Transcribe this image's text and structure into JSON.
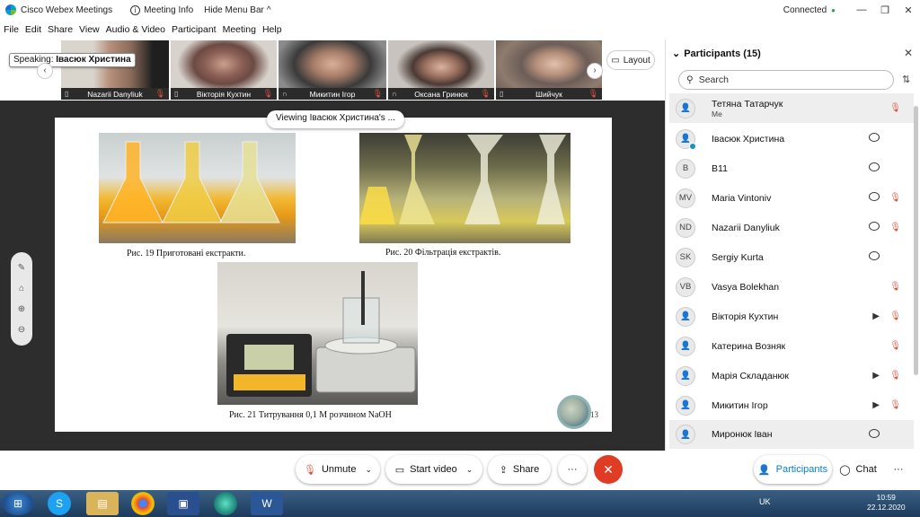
{
  "titlebar": {
    "app": "Cisco Webex Meetings",
    "meeting_info": "Meeting Info",
    "hide_menu": "Hide Menu Bar",
    "status": "Connected",
    "status_color": "#2ea043"
  },
  "menu": [
    "File",
    "Edit",
    "Share",
    "View",
    "Audio & Video",
    "Participant",
    "Meeting",
    "Help"
  ],
  "speaking": {
    "label": "Speaking:",
    "name": "Івасюк Христина"
  },
  "tiles": [
    "Nazarii Danyliuk",
    "Вікторія Кухтин",
    "Микитин Ігор",
    "Оксана Гринюк",
    "Шийчук"
  ],
  "layout_label": "Layout",
  "viewing": "Viewing Івасюк Христина's ...",
  "slide": {
    "cap19": "Рис. 19  Приготовані екстракти.",
    "cap20": "Рис. 20  Фільтрація екстрактів.",
    "cap21": "Рис. 21  Титрування  0,1 М розчином NaOH",
    "page": "13"
  },
  "panel": {
    "title": "Participants (15)",
    "search_placeholder": "Search",
    "participants": [
      {
        "initials": "",
        "name": "Тетяна Татарчук",
        "sub": "Me",
        "r1": "",
        "muted": true
      },
      {
        "initials": "",
        "name": "Івасюк Христина",
        "sub": "",
        "r1": "chat",
        "muted": false
      },
      {
        "initials": "B",
        "name": "B11",
        "sub": "",
        "r1": "chat",
        "muted": false
      },
      {
        "initials": "MV",
        "name": "Maria Vintoniv",
        "sub": "",
        "r1": "chat",
        "muted": true
      },
      {
        "initials": "ND",
        "name": "Nazarii Danyliuk",
        "sub": "",
        "r1": "chat",
        "muted": true
      },
      {
        "initials": "SK",
        "name": "Sergiy Kurta",
        "sub": "",
        "r1": "chat",
        "muted": false
      },
      {
        "initials": "VB",
        "name": "Vasya Bolekhan",
        "sub": "",
        "r1": "",
        "muted": true
      },
      {
        "initials": "",
        "name": "Вікторія Кухтин",
        "sub": "",
        "r1": "video",
        "muted": true
      },
      {
        "initials": "",
        "name": "Катерина Возняк",
        "sub": "",
        "r1": "",
        "muted": true
      },
      {
        "initials": "",
        "name": "Марія Складанюк",
        "sub": "",
        "r1": "video",
        "muted": true
      },
      {
        "initials": "",
        "name": "Микитин Ігор",
        "sub": "",
        "r1": "video",
        "muted": true
      },
      {
        "initials": "",
        "name": "Миронюк Іван",
        "sub": "",
        "r1": "chat",
        "muted": false
      }
    ]
  },
  "controls": {
    "unmute": "Unmute",
    "start_video": "Start video",
    "share": "Share",
    "participants": "Participants",
    "chat": "Chat"
  },
  "taskbar": {
    "lang": "UK",
    "time": "10:59",
    "date": "22.12.2020"
  },
  "colors": {
    "accent": "#0a7fc2",
    "end": "#e03b24",
    "mute": "#e0523a"
  }
}
